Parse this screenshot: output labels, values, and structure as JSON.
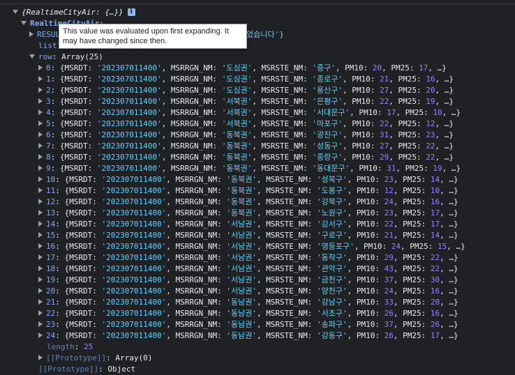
{
  "root": {
    "label": "{RealtimeCityAir: {…}}",
    "info_glyph": "i"
  },
  "city_air": {
    "key": "RealtimeCityAir:"
  },
  "result": {
    "key": "RESUL",
    "tail": "되었습니다'}"
  },
  "list_line": {
    "key": "list"
  },
  "tooltip": {
    "text": "This value was evaluated upon first expanding. It may have changed since then."
  },
  "row_header": {
    "key": "row",
    "value": "Array(25)"
  },
  "rows": [
    {
      "i": "0",
      "date": "'202307011400'",
      "region": "'도심권'",
      "station": "'중구'",
      "pm10": "20",
      "pm25": "17"
    },
    {
      "i": "1",
      "date": "'202307011400'",
      "region": "'도심권'",
      "station": "'종로구'",
      "pm10": "21",
      "pm25": "16"
    },
    {
      "i": "2",
      "date": "'202307011400'",
      "region": "'도심권'",
      "station": "'용산구'",
      "pm10": "27",
      "pm25": "20"
    },
    {
      "i": "3",
      "date": "'202307011400'",
      "region": "'서북권'",
      "station": "'은평구'",
      "pm10": "22",
      "pm25": "19"
    },
    {
      "i": "4",
      "date": "'202307011400'",
      "region": "'서북권'",
      "station": "'서대문구'",
      "pm10": "17",
      "pm25": "10"
    },
    {
      "i": "5",
      "date": "'202307011400'",
      "region": "'서북권'",
      "station": "'마포구'",
      "pm10": "22",
      "pm25": "12"
    },
    {
      "i": "6",
      "date": "'202307011400'",
      "region": "'동북권'",
      "station": "'광진구'",
      "pm10": "31",
      "pm25": "23"
    },
    {
      "i": "7",
      "date": "'202307011400'",
      "region": "'동북권'",
      "station": "'성동구'",
      "pm10": "27",
      "pm25": "22"
    },
    {
      "i": "8",
      "date": "'202307011400'",
      "region": "'동북권'",
      "station": "'중랑구'",
      "pm10": "29",
      "pm25": "22"
    },
    {
      "i": "9",
      "date": "'202307011400'",
      "region": "'동북권'",
      "station": "'동대문구'",
      "pm10": "31",
      "pm25": "19"
    },
    {
      "i": "10",
      "date": "'202307011400'",
      "region": "'동북권'",
      "station": "'성북구'",
      "pm10": "23",
      "pm25": "14"
    },
    {
      "i": "11",
      "date": "'202307011400'",
      "region": "'동북권'",
      "station": "'도봉구'",
      "pm10": "12",
      "pm25": "10"
    },
    {
      "i": "12",
      "date": "'202307011400'",
      "region": "'동북권'",
      "station": "'강북구'",
      "pm10": "24",
      "pm25": "16"
    },
    {
      "i": "13",
      "date": "'202307011400'",
      "region": "'동북권'",
      "station": "'노원구'",
      "pm10": "23",
      "pm25": "17"
    },
    {
      "i": "14",
      "date": "'202307011400'",
      "region": "'서남권'",
      "station": "'강서구'",
      "pm10": "22",
      "pm25": "17"
    },
    {
      "i": "15",
      "date": "'202307011400'",
      "region": "'서남권'",
      "station": "'구로구'",
      "pm10": "21",
      "pm25": "14"
    },
    {
      "i": "16",
      "date": "'202307011400'",
      "region": "'서남권'",
      "station": "'영등포구'",
      "pm10": "24",
      "pm25": "15"
    },
    {
      "i": "17",
      "date": "'202307011400'",
      "region": "'서남권'",
      "station": "'동작구'",
      "pm10": "29",
      "pm25": "22"
    },
    {
      "i": "18",
      "date": "'202307011400'",
      "region": "'서남권'",
      "station": "'관악구'",
      "pm10": "43",
      "pm25": "22"
    },
    {
      "i": "19",
      "date": "'202307011400'",
      "region": "'서남권'",
      "station": "'금천구'",
      "pm10": "37",
      "pm25": "30"
    },
    {
      "i": "20",
      "date": "'202307011400'",
      "region": "'서남권'",
      "station": "'양천구'",
      "pm10": "24",
      "pm25": "16"
    },
    {
      "i": "21",
      "date": "'202307011400'",
      "region": "'동남권'",
      "station": "'강남구'",
      "pm10": "33",
      "pm25": "20"
    },
    {
      "i": "22",
      "date": "'202307011400'",
      "region": "'동남권'",
      "station": "'서초구'",
      "pm10": "26",
      "pm25": "16"
    },
    {
      "i": "23",
      "date": "'202307011400'",
      "region": "'동남권'",
      "station": "'송파구'",
      "pm10": "37",
      "pm25": "26"
    },
    {
      "i": "24",
      "date": "'202307011400'",
      "region": "'동남권'",
      "station": "'강동구'",
      "pm10": "26",
      "pm25": "17"
    }
  ],
  "labels": {
    "msrdt": "MSRDT",
    "msrrgn": "MSRRGN_NM",
    "msrste": "MSRSTE_NM",
    "pm10": "PM10",
    "pm25": "PM25",
    "ellipsis": "…"
  },
  "length_line": {
    "key": "length",
    "value": "25"
  },
  "prototype_line": {
    "key": "[[Prototype]]",
    "value": "Array(0)"
  },
  "prototype_partial": {
    "key": "[[Prototype]]",
    "value": "Object"
  }
}
